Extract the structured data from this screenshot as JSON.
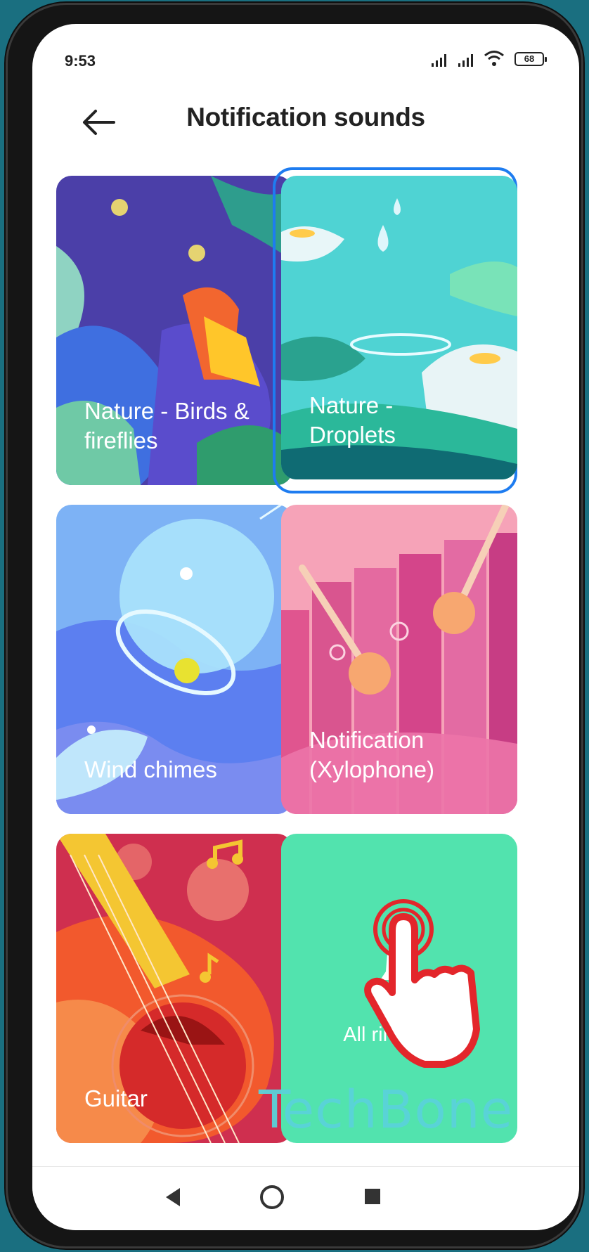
{
  "status_bar": {
    "time": "9:53",
    "battery": "68"
  },
  "header": {
    "title": "Notification sounds"
  },
  "cards": [
    {
      "label_line1": "Nature - Birds &",
      "label_line2": "fireflies",
      "selected": false
    },
    {
      "label_line1": "Nature -",
      "label_line2": "Droplets",
      "selected": true
    },
    {
      "label_line1": "Wind chimes",
      "label_line2": "",
      "selected": false
    },
    {
      "label_line1": "Notification",
      "label_line2": "(Xylophone)",
      "selected": false
    },
    {
      "label_line1": "Guitar",
      "label_line2": "",
      "selected": false
    },
    {
      "label_line1": "All ringtones",
      "label_line2": "",
      "selected": false
    }
  ],
  "watermark": "TechBone",
  "colors": {
    "selection": "#1e7cf0",
    "all_ringtones_bg": "#52e3ae",
    "page_bg": "#1a6f80"
  },
  "icons": [
    "back-arrow-icon",
    "signal-icon",
    "wifi-icon",
    "battery-icon",
    "bell-icon",
    "tap-hand-icon",
    "nav-back-icon",
    "nav-home-icon",
    "nav-recents-icon"
  ]
}
